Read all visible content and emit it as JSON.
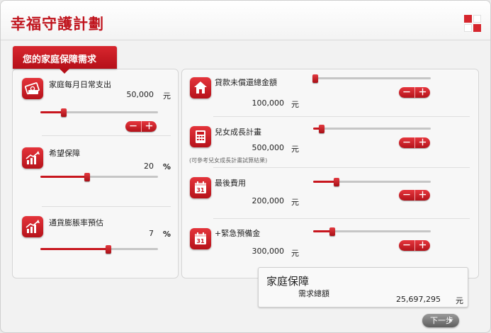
{
  "app": {
    "title": "幸福守護計劃"
  },
  "section": {
    "title": "您的家庭保障需求"
  },
  "left": {
    "items": [
      {
        "label": "家庭每月日常支出",
        "value": "50,000",
        "unit": "元",
        "slider": 0.2
      },
      {
        "label": "希望保障",
        "value": "20",
        "unit": "%",
        "slider": 0.4
      },
      {
        "label": "通貨膨脹率預估",
        "value": "7",
        "unit": "%",
        "slider": 0.58
      }
    ]
  },
  "right": {
    "items": [
      {
        "label": "貸款未償還總金額",
        "value": "100,000",
        "unit": "元",
        "slider": 0.02
      },
      {
        "label": "兒女成長計畫",
        "value": "500,000",
        "unit": "元",
        "slider": 0.07,
        "note": "(可參考兒女成長計畫試算結果)"
      },
      {
        "label": "最後費用",
        "value": "200,000",
        "unit": "元",
        "slider": 0.2
      },
      {
        "label": "+緊急預備金",
        "value": "300,000",
        "unit": "元",
        "slider": 0.16
      }
    ]
  },
  "stepper": {
    "minus": "－",
    "plus": "＋"
  },
  "summary": {
    "title": "家庭保障",
    "subtitle": "需求總額",
    "value": "25,697,295",
    "unit": "元"
  },
  "next": {
    "label": "下一步",
    "arrow": "▸"
  },
  "colors": {
    "accent": "#c0151e",
    "track": "#c6c6c6"
  },
  "icons": [
    "money-icon",
    "chart-icon",
    "chart-icon",
    "house-icon",
    "calculator-icon",
    "calendar-icon",
    "calendar-icon"
  ]
}
